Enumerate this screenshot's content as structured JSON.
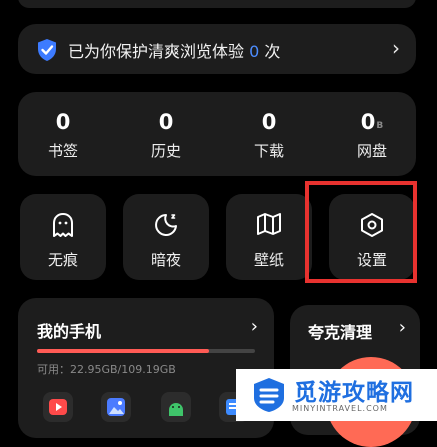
{
  "protect": {
    "prefix": "已为你保护清爽浏览体验",
    "count": "0",
    "suffix": "次"
  },
  "stats": [
    {
      "value": "0",
      "label": "书签"
    },
    {
      "value": "0",
      "label": "历史"
    },
    {
      "value": "0",
      "label": "下载"
    },
    {
      "value": "0",
      "unit": "B",
      "label": "网盘"
    }
  ],
  "tools": [
    {
      "label": "无痕",
      "icon": "ghost-icon"
    },
    {
      "label": "暗夜",
      "icon": "moon-icon"
    },
    {
      "label": "壁纸",
      "icon": "map-book-icon"
    },
    {
      "label": "设置",
      "icon": "hexagon-settings-icon"
    }
  ],
  "my_phone": {
    "title": "我的手机",
    "storage_text": "可用：22.95GB/109.19GB",
    "storage_used_fraction": 0.79,
    "apps": [
      "video-app-icon",
      "gallery-app-icon",
      "android-app-icon",
      "files-app-icon"
    ]
  },
  "quark_clean": {
    "title": "夸克清理"
  },
  "watermark": {
    "title": "觅游攻略网",
    "subtitle": "MINYINTRAVEL.COM"
  },
  "colors": {
    "accent": "#4d8dff",
    "highlight": "#e8322f",
    "progress": "#ff5b55",
    "card": "#1d1d1d"
  }
}
